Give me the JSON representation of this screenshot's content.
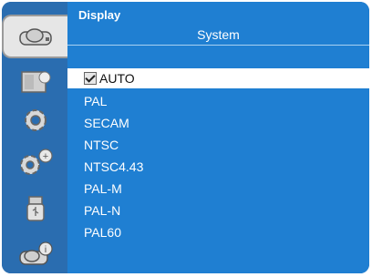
{
  "header": {
    "title": "Display"
  },
  "section": {
    "title": "System"
  },
  "sidebar": {
    "items": [
      {
        "name": "display",
        "icon": "projector-display-icon",
        "selected": true
      },
      {
        "name": "image",
        "icon": "image-settings-icon",
        "selected": false
      },
      {
        "name": "setting",
        "icon": "gear-icon",
        "selected": false
      },
      {
        "name": "expanded",
        "icon": "expanded-gear-icon",
        "selected": false
      },
      {
        "name": "usb",
        "icon": "usb-icon",
        "selected": false
      },
      {
        "name": "info",
        "icon": "info-icon",
        "selected": false
      }
    ]
  },
  "options": [
    {
      "label": "AUTO",
      "checked": true
    },
    {
      "label": "PAL"
    },
    {
      "label": "SECAM"
    },
    {
      "label": "NTSC"
    },
    {
      "label": "NTSC4.43"
    },
    {
      "label": "PAL-M"
    },
    {
      "label": "PAL-N"
    },
    {
      "label": "PAL60"
    }
  ],
  "colors": {
    "background": "#1f7fd2",
    "sidebar": "#2a6db0",
    "selected_row": "#ffffff",
    "text": "#ffffff"
  }
}
